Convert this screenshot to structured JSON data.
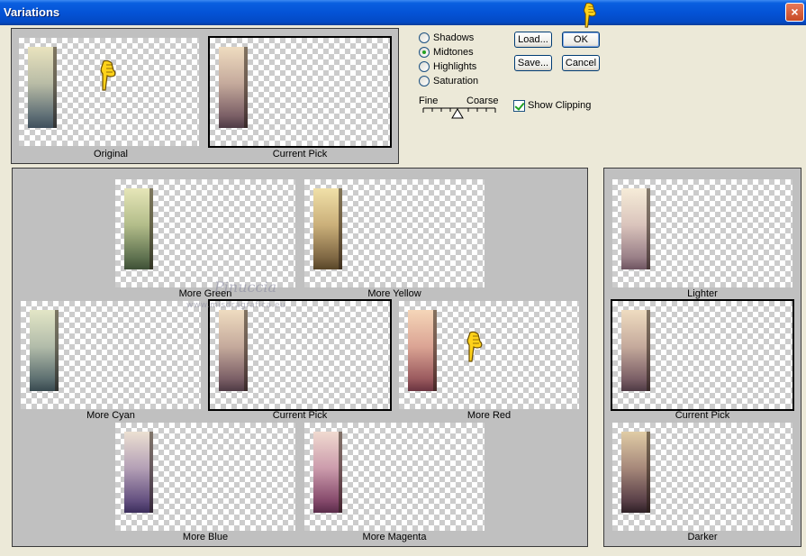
{
  "window": {
    "title": "Variations",
    "close_glyph": "×"
  },
  "preview": {
    "original_caption": "Original",
    "current_pick_caption": "Current Pick"
  },
  "tones": {
    "options": [
      "Shadows",
      "Midtones",
      "Highlights",
      "Saturation"
    ],
    "selected": "Midtones"
  },
  "slider": {
    "fine_label": "Fine",
    "coarse_label": "Coarse"
  },
  "buttons": {
    "load": "Load...",
    "save": "Save...",
    "ok": "OK",
    "cancel": "Cancel"
  },
  "show_clipping": {
    "label": "Show Clipping",
    "checked": true
  },
  "color_grid": {
    "more_green": "More Green",
    "more_yellow": "More Yellow",
    "more_cyan": "More Cyan",
    "current_pick": "Current Pick",
    "more_red": "More Red",
    "more_blue": "More Blue",
    "more_magenta": "More Magenta"
  },
  "lightness": {
    "lighter": "Lighter",
    "current_pick": "Current Pick",
    "darker": "Darker"
  },
  "watermark": {
    "name": "Pinuccia",
    "site": "www.misdragrafica.eu"
  },
  "colors": {
    "title_bar": "#0453d6",
    "panel_bg": "#c0c0c0",
    "dialog_bg": "#ece9d8",
    "original_gradient": [
      "#e8e2c0",
      "#9aa6a0",
      "#4a5a66"
    ],
    "current_gradient": [
      "#efdcc0",
      "#a88c86",
      "#4e3a44"
    ]
  }
}
